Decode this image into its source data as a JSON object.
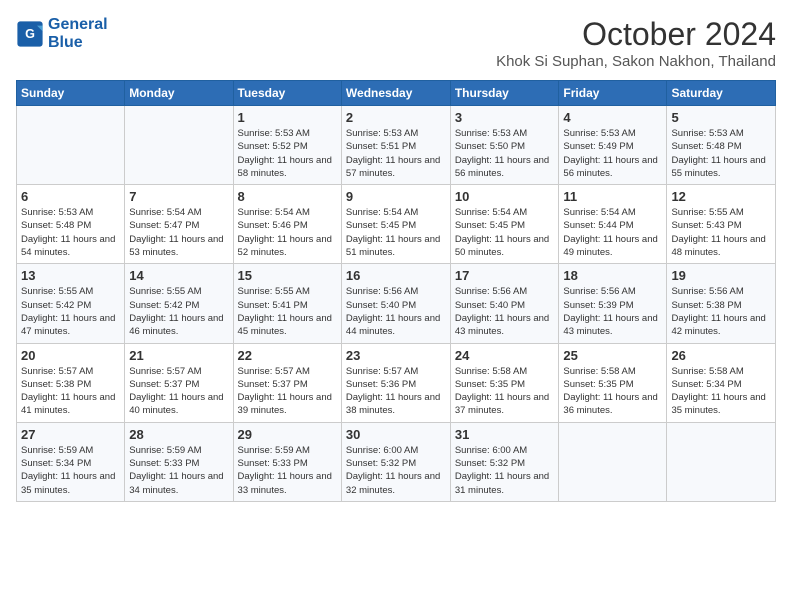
{
  "header": {
    "logo_line1": "General",
    "logo_line2": "Blue",
    "month_year": "October 2024",
    "location": "Khok Si Suphan, Sakon Nakhon, Thailand"
  },
  "weekdays": [
    "Sunday",
    "Monday",
    "Tuesday",
    "Wednesday",
    "Thursday",
    "Friday",
    "Saturday"
  ],
  "weeks": [
    [
      {
        "day": "",
        "sunrise": "",
        "sunset": "",
        "daylight": ""
      },
      {
        "day": "",
        "sunrise": "",
        "sunset": "",
        "daylight": ""
      },
      {
        "day": "1",
        "sunrise": "Sunrise: 5:53 AM",
        "sunset": "Sunset: 5:52 PM",
        "daylight": "Daylight: 11 hours and 58 minutes."
      },
      {
        "day": "2",
        "sunrise": "Sunrise: 5:53 AM",
        "sunset": "Sunset: 5:51 PM",
        "daylight": "Daylight: 11 hours and 57 minutes."
      },
      {
        "day": "3",
        "sunrise": "Sunrise: 5:53 AM",
        "sunset": "Sunset: 5:50 PM",
        "daylight": "Daylight: 11 hours and 56 minutes."
      },
      {
        "day": "4",
        "sunrise": "Sunrise: 5:53 AM",
        "sunset": "Sunset: 5:49 PM",
        "daylight": "Daylight: 11 hours and 56 minutes."
      },
      {
        "day": "5",
        "sunrise": "Sunrise: 5:53 AM",
        "sunset": "Sunset: 5:48 PM",
        "daylight": "Daylight: 11 hours and 55 minutes."
      }
    ],
    [
      {
        "day": "6",
        "sunrise": "Sunrise: 5:53 AM",
        "sunset": "Sunset: 5:48 PM",
        "daylight": "Daylight: 11 hours and 54 minutes."
      },
      {
        "day": "7",
        "sunrise": "Sunrise: 5:54 AM",
        "sunset": "Sunset: 5:47 PM",
        "daylight": "Daylight: 11 hours and 53 minutes."
      },
      {
        "day": "8",
        "sunrise": "Sunrise: 5:54 AM",
        "sunset": "Sunset: 5:46 PM",
        "daylight": "Daylight: 11 hours and 52 minutes."
      },
      {
        "day": "9",
        "sunrise": "Sunrise: 5:54 AM",
        "sunset": "Sunset: 5:45 PM",
        "daylight": "Daylight: 11 hours and 51 minutes."
      },
      {
        "day": "10",
        "sunrise": "Sunrise: 5:54 AM",
        "sunset": "Sunset: 5:45 PM",
        "daylight": "Daylight: 11 hours and 50 minutes."
      },
      {
        "day": "11",
        "sunrise": "Sunrise: 5:54 AM",
        "sunset": "Sunset: 5:44 PM",
        "daylight": "Daylight: 11 hours and 49 minutes."
      },
      {
        "day": "12",
        "sunrise": "Sunrise: 5:55 AM",
        "sunset": "Sunset: 5:43 PM",
        "daylight": "Daylight: 11 hours and 48 minutes."
      }
    ],
    [
      {
        "day": "13",
        "sunrise": "Sunrise: 5:55 AM",
        "sunset": "Sunset: 5:42 PM",
        "daylight": "Daylight: 11 hours and 47 minutes."
      },
      {
        "day": "14",
        "sunrise": "Sunrise: 5:55 AM",
        "sunset": "Sunset: 5:42 PM",
        "daylight": "Daylight: 11 hours and 46 minutes."
      },
      {
        "day": "15",
        "sunrise": "Sunrise: 5:55 AM",
        "sunset": "Sunset: 5:41 PM",
        "daylight": "Daylight: 11 hours and 45 minutes."
      },
      {
        "day": "16",
        "sunrise": "Sunrise: 5:56 AM",
        "sunset": "Sunset: 5:40 PM",
        "daylight": "Daylight: 11 hours and 44 minutes."
      },
      {
        "day": "17",
        "sunrise": "Sunrise: 5:56 AM",
        "sunset": "Sunset: 5:40 PM",
        "daylight": "Daylight: 11 hours and 43 minutes."
      },
      {
        "day": "18",
        "sunrise": "Sunrise: 5:56 AM",
        "sunset": "Sunset: 5:39 PM",
        "daylight": "Daylight: 11 hours and 43 minutes."
      },
      {
        "day": "19",
        "sunrise": "Sunrise: 5:56 AM",
        "sunset": "Sunset: 5:38 PM",
        "daylight": "Daylight: 11 hours and 42 minutes."
      }
    ],
    [
      {
        "day": "20",
        "sunrise": "Sunrise: 5:57 AM",
        "sunset": "Sunset: 5:38 PM",
        "daylight": "Daylight: 11 hours and 41 minutes."
      },
      {
        "day": "21",
        "sunrise": "Sunrise: 5:57 AM",
        "sunset": "Sunset: 5:37 PM",
        "daylight": "Daylight: 11 hours and 40 minutes."
      },
      {
        "day": "22",
        "sunrise": "Sunrise: 5:57 AM",
        "sunset": "Sunset: 5:37 PM",
        "daylight": "Daylight: 11 hours and 39 minutes."
      },
      {
        "day": "23",
        "sunrise": "Sunrise: 5:57 AM",
        "sunset": "Sunset: 5:36 PM",
        "daylight": "Daylight: 11 hours and 38 minutes."
      },
      {
        "day": "24",
        "sunrise": "Sunrise: 5:58 AM",
        "sunset": "Sunset: 5:35 PM",
        "daylight": "Daylight: 11 hours and 37 minutes."
      },
      {
        "day": "25",
        "sunrise": "Sunrise: 5:58 AM",
        "sunset": "Sunset: 5:35 PM",
        "daylight": "Daylight: 11 hours and 36 minutes."
      },
      {
        "day": "26",
        "sunrise": "Sunrise: 5:58 AM",
        "sunset": "Sunset: 5:34 PM",
        "daylight": "Daylight: 11 hours and 35 minutes."
      }
    ],
    [
      {
        "day": "27",
        "sunrise": "Sunrise: 5:59 AM",
        "sunset": "Sunset: 5:34 PM",
        "daylight": "Daylight: 11 hours and 35 minutes."
      },
      {
        "day": "28",
        "sunrise": "Sunrise: 5:59 AM",
        "sunset": "Sunset: 5:33 PM",
        "daylight": "Daylight: 11 hours and 34 minutes."
      },
      {
        "day": "29",
        "sunrise": "Sunrise: 5:59 AM",
        "sunset": "Sunset: 5:33 PM",
        "daylight": "Daylight: 11 hours and 33 minutes."
      },
      {
        "day": "30",
        "sunrise": "Sunrise: 6:00 AM",
        "sunset": "Sunset: 5:32 PM",
        "daylight": "Daylight: 11 hours and 32 minutes."
      },
      {
        "day": "31",
        "sunrise": "Sunrise: 6:00 AM",
        "sunset": "Sunset: 5:32 PM",
        "daylight": "Daylight: 11 hours and 31 minutes."
      },
      {
        "day": "",
        "sunrise": "",
        "sunset": "",
        "daylight": ""
      },
      {
        "day": "",
        "sunrise": "",
        "sunset": "",
        "daylight": ""
      }
    ]
  ]
}
